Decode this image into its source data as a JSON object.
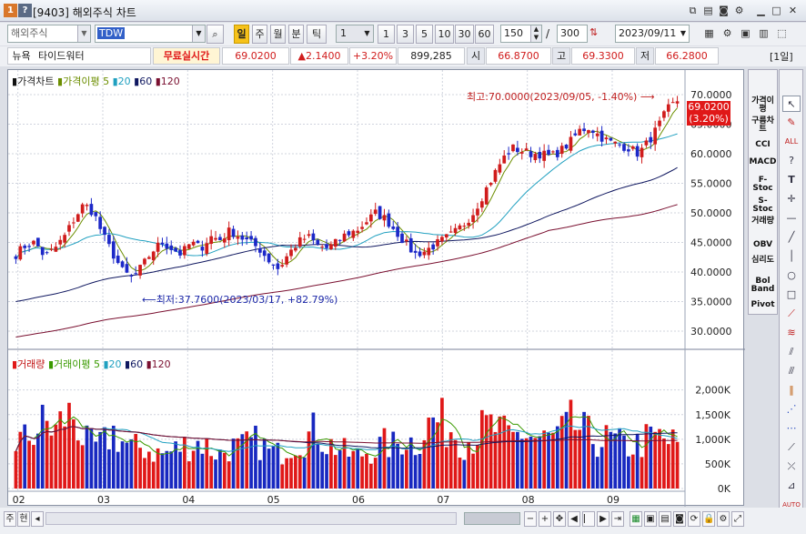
{
  "window": {
    "title": "[9403] 해외주식 차트",
    "title_icon_a": "1",
    "title_icon_b": "?"
  },
  "toolbar": {
    "market": "해외주식",
    "symbol": "TDW",
    "periods": [
      "일",
      "주",
      "월",
      "분",
      "틱"
    ],
    "interval_select": "1",
    "intervals": [
      "1",
      "3",
      "5",
      "10",
      "30",
      "60"
    ],
    "count": "150",
    "slash": "/",
    "total": "300",
    "date": "2023/09/11"
  },
  "quote": {
    "exchange": "뉴욕",
    "name": "타이드워터",
    "realtime": "무료실시간",
    "price": "69.0200",
    "change": "▲2.1400",
    "change_pct": "+3.20%",
    "volume": "899,285",
    "open_label": "시",
    "open": "66.8700",
    "high_label": "고",
    "high": "69.3300",
    "low_label": "저",
    "low": "66.2800",
    "period_badge": "[1일]"
  },
  "price_legend": {
    "title": "가격차트",
    "ma_label": "가격이평",
    "ma_periods": [
      "5",
      "20",
      "60",
      "120"
    ]
  },
  "volume_legend": {
    "title": "거래량",
    "ma_label": "거래이평",
    "ma_periods": [
      "5",
      "20",
      "60",
      "120"
    ]
  },
  "annotations": {
    "high": "최고:70.0000(2023/09/05, -1.40%)",
    "low": "최저:37.7600(2023/03/17, +82.79%)",
    "current_price": "69.0200",
    "current_pct": "(3.20%)"
  },
  "right_panel": [
    "가격이평",
    "구름차트",
    "CCI",
    "MACD",
    "F-Stoc",
    "S-Stoc",
    "거래량",
    "OBV",
    "심리도",
    "Bol Band",
    "Pivot"
  ],
  "bottom": {
    "mode_a": "주",
    "mode_b": "현"
  },
  "colors": {
    "up": "#d01c1c",
    "down": "#1c28c8",
    "ma5": "#6c8e00",
    "ma20": "#20a0c0",
    "ma60": "#101860",
    "ma120": "#7a1030",
    "volume_ma5": "#3a9a00",
    "volume_up": "#e01818",
    "volume_down": "#1828c0"
  },
  "chart_data": {
    "type": "candlestick",
    "x_ticks": [
      "02",
      "03",
      "04",
      "05",
      "06",
      "07",
      "08",
      "09"
    ],
    "price_axis": {
      "ticks": [
        "30.0000",
        "35.0000",
        "40.0000",
        "45.0000",
        "50.0000",
        "55.0000",
        "60.0000",
        "65.0000",
        "70.0000"
      ],
      "ylim": [
        28,
        72
      ]
    },
    "volume_axis": {
      "ticks": [
        "0K",
        "500K",
        "1,000K",
        "1,500K",
        "2,000K"
      ],
      "ylim": [
        0,
        2400
      ]
    },
    "anchors": [
      43,
      44.5,
      45,
      42.5,
      44,
      46,
      49,
      51.5,
      50,
      46,
      43,
      40,
      39,
      41,
      43.5,
      45,
      44,
      43,
      45,
      44,
      46,
      45.5,
      47,
      46,
      45,
      44,
      42,
      40.5,
      43,
      45,
      46,
      44.5,
      44,
      45,
      46.5,
      47,
      48.5,
      50,
      49,
      47,
      45,
      43,
      43.5,
      44.5,
      45.5,
      46.5,
      48,
      50,
      53,
      56,
      59,
      61,
      60.5,
      60,
      60,
      59.5,
      60.5,
      62,
      64,
      64.5,
      63,
      62,
      61.5,
      61,
      60,
      62,
      64.5,
      67.5,
      69
    ],
    "volume_anchors": [
      950,
      1000,
      1150,
      1350,
      1150,
      1450,
      1500,
      950,
      850,
      900,
      1150,
      950,
      800,
      850,
      750,
      700,
      750,
      850,
      900,
      950,
      800,
      700,
      850,
      800,
      900,
      950,
      750,
      700,
      900,
      1000,
      1050,
      1200,
      900,
      850,
      700,
      650,
      750,
      800,
      900,
      850,
      1050,
      900,
      1200,
      1400,
      1300,
      1200,
      950,
      1050,
      1200,
      1250,
      1100,
      1000,
      1150,
      1050,
      1000,
      1000,
      1100,
      1300,
      1200,
      1050,
      950,
      1000,
      900,
      850,
      900,
      1000,
      1050,
      950,
      900
    ]
  }
}
